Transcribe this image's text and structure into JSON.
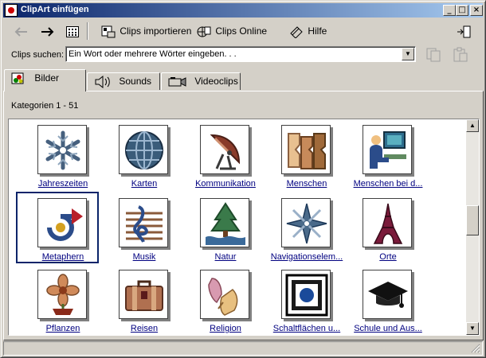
{
  "window": {
    "title": "ClipArt einfügen"
  },
  "toolbar": {
    "back_icon": "arrow-left-icon",
    "forward_icon": "arrow-right-icon",
    "view_icon": "grid-view-icon",
    "import_label": "Clips importieren",
    "online_label": "Clips Online",
    "help_label": "Hilfe",
    "restore_icon": "change-window-size-icon"
  },
  "search": {
    "label": "Clips suchen:",
    "value": "Ein Wort oder mehrere Wörter eingeben. . .",
    "copy_icon": "copy-icon",
    "paste_icon": "paste-icon"
  },
  "tabs": [
    {
      "label": "Bilder",
      "icon": "pictures-icon"
    },
    {
      "label": "Sounds",
      "icon": "speaker-icon"
    },
    {
      "label": "Videoclips",
      "icon": "camera-icon"
    }
  ],
  "categories": {
    "count_label": "Kategorien 1 - 51",
    "items": [
      {
        "label": "Jahreszeiten",
        "icon": "snowflake-icon"
      },
      {
        "label": "Karten",
        "icon": "globe-icon"
      },
      {
        "label": "Kommunikation",
        "icon": "satellite-dish-icon"
      },
      {
        "label": "Menschen",
        "icon": "people-icon"
      },
      {
        "label": "Menschen bei d...",
        "icon": "person-at-computer-icon"
      },
      {
        "label": "Metaphern",
        "icon": "metaphor-arrow-icon"
      },
      {
        "label": "Musik",
        "icon": "treble-clef-icon"
      },
      {
        "label": "Natur",
        "icon": "tree-icon"
      },
      {
        "label": "Navigationselem...",
        "icon": "compass-star-icon"
      },
      {
        "label": "Orte",
        "icon": "eiffel-tower-icon"
      },
      {
        "label": "Pflanzen",
        "icon": "flower-icon"
      },
      {
        "label": "Reisen",
        "icon": "suitcase-icon"
      },
      {
        "label": "Religion",
        "icon": "praying-hands-icon"
      },
      {
        "label": "Schaltflächen u...",
        "icon": "button-icon"
      },
      {
        "label": "Schule und Aus...",
        "icon": "graduation-cap-icon"
      }
    ],
    "selected": "Metaphern"
  }
}
